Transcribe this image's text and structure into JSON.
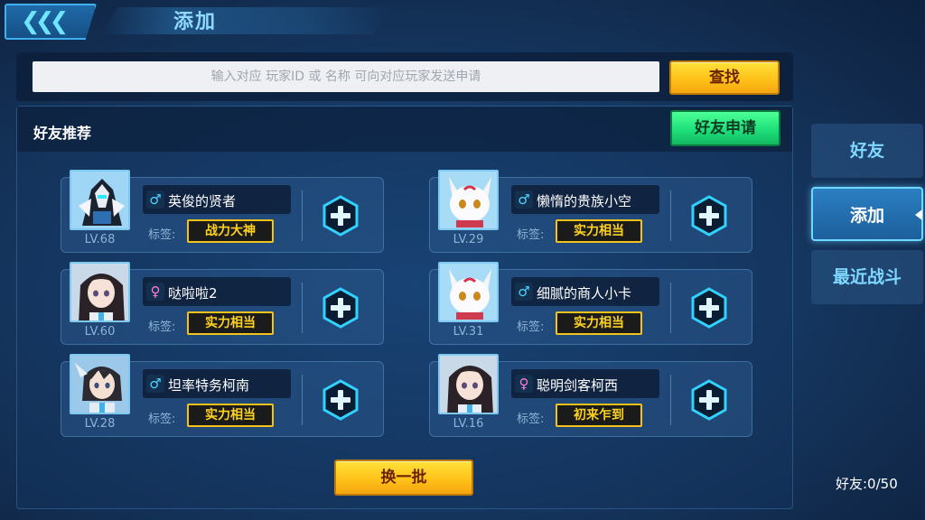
{
  "header": {
    "back_icon": "double-chevron-left-icon",
    "title": "添加"
  },
  "search": {
    "placeholder": "输入对应 玩家ID 或 名称 可向对应玩家发送申请",
    "value": "",
    "button_label": "查找"
  },
  "recommend": {
    "title": "好友推荐",
    "request_button_label": "好友申请",
    "tag_label": "标签:",
    "players": [
      {
        "name": "英俊的贤者",
        "gender": "male",
        "gender_icon": "♂",
        "level": "LV.68",
        "tag": "战力大神",
        "avatar": "mecha-avatar"
      },
      {
        "name": "懒惰的贵族小空",
        "gender": "male",
        "gender_icon": "♂",
        "level": "LV.29",
        "tag": "实力相当",
        "avatar": "white-fox-avatar"
      },
      {
        "name": "哒啦啦2",
        "gender": "female",
        "gender_icon": "♀",
        "level": "LV.60",
        "tag": "实力相当",
        "avatar": "girl-avatar"
      },
      {
        "name": "细腻的商人小卡",
        "gender": "male",
        "gender_icon": "♂",
        "level": "LV.31",
        "tag": "实力相当",
        "avatar": "white-fox-avatar"
      },
      {
        "name": "坦率特务柯南",
        "gender": "male",
        "gender_icon": "♂",
        "level": "LV.28",
        "tag": "实力相当",
        "avatar": "boy-avatar"
      },
      {
        "name": "聪明剑客柯西",
        "gender": "female",
        "gender_icon": "♀",
        "level": "LV.16",
        "tag": "初来乍到",
        "avatar": "girl-avatar"
      }
    ],
    "refresh_button_label": "换一批"
  },
  "sidebar": {
    "tabs": [
      {
        "label": "好友",
        "active": false
      },
      {
        "label": "添加",
        "active": true
      },
      {
        "label": "最近战斗",
        "active": false
      }
    ],
    "friend_count": "好友:0/50"
  },
  "colors": {
    "accent_cyan": "#6fd8ff",
    "button_yellow": "#ffc21a",
    "button_green": "#1ee07a",
    "tag_border": "#f3c21b"
  }
}
